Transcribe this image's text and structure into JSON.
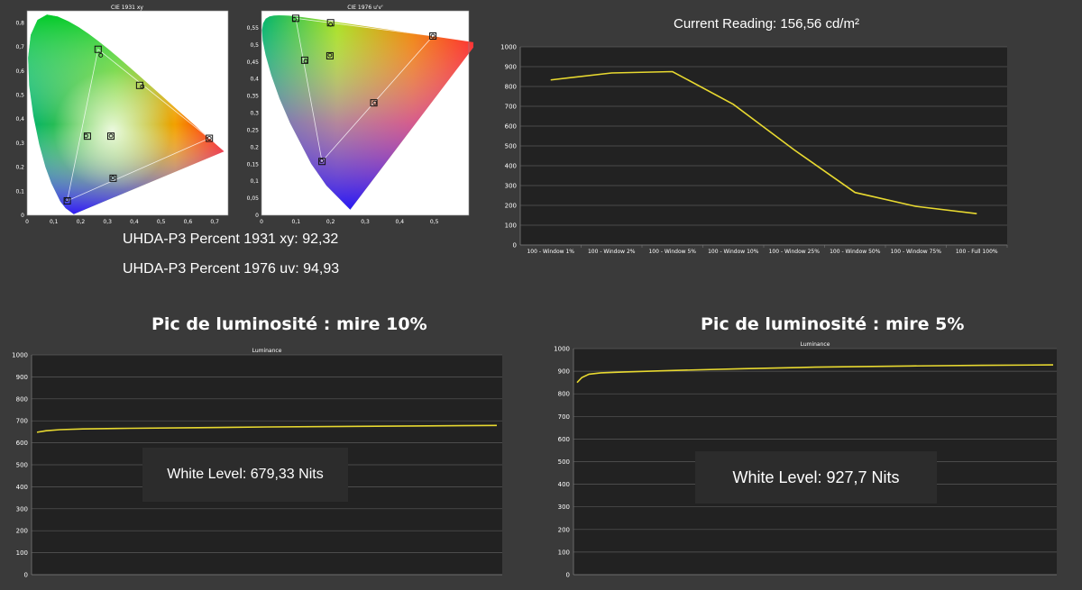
{
  "colors": {
    "background": "#3a3a3a",
    "plot_bg": "#222222",
    "grid": "#5a5a5a",
    "line": "#e8d930",
    "text": "#ffffff"
  },
  "cie1931": {
    "title": "CIE 1931 xy",
    "caption": "UHDA-P3 Percent 1931 xy: 92,32"
  },
  "cie1976": {
    "title": "CIE 1976 u'v'",
    "caption": "UHDA-P3 Percent 1976 uv: 94,93"
  },
  "reading": {
    "title": "Current Reading: 156,56 cd/m²"
  },
  "peak10": {
    "heading": "Pic de luminosité : mire 10%",
    "white_level": "White Level: 679,33 Nits"
  },
  "peak5": {
    "heading": "Pic de luminosité : mire 5%",
    "white_level": "White Level: 927,7 Nits"
  },
  "chart_data": [
    {
      "id": "cie1931",
      "type": "scatter",
      "title": "CIE 1931 xy",
      "xlim": [
        0,
        0.75
      ],
      "ylim": [
        0,
        0.85
      ],
      "x_ticks": [
        0,
        0.1,
        0.2,
        0.3,
        0.4,
        0.5,
        0.6,
        0.7
      ],
      "y_ticks": [
        0,
        0.1,
        0.2,
        0.3,
        0.4,
        0.5,
        0.6,
        0.7,
        0.8
      ],
      "x_tick_labels": [
        "0",
        "0,1",
        "0,2",
        "0,3",
        "0,4",
        "0,5",
        "0,6",
        "0,7"
      ],
      "y_tick_labels": [
        "0",
        "0,1",
        "0,2",
        "0,3",
        "0,4",
        "0,5",
        "0,6",
        "0,7",
        "0,8"
      ],
      "target_points": [
        [
          0.68,
          0.32
        ],
        [
          0.265,
          0.69
        ],
        [
          0.15,
          0.06
        ],
        [
          0.3127,
          0.329
        ],
        [
          0.225,
          0.329
        ],
        [
          0.321,
          0.154
        ],
        [
          0.42,
          0.54
        ]
      ],
      "measured_points": [
        [
          0.68,
          0.32
        ],
        [
          0.275,
          0.665
        ],
        [
          0.148,
          0.065
        ],
        [
          0.313,
          0.33
        ],
        [
          0.22,
          0.33
        ],
        [
          0.32,
          0.155
        ],
        [
          0.43,
          0.535
        ]
      ]
    },
    {
      "id": "cie1976",
      "type": "scatter",
      "title": "CIE 1976 u'v'",
      "xlim": [
        0,
        0.6
      ],
      "ylim": [
        0,
        0.6
      ],
      "x_ticks": [
        0,
        0.1,
        0.2,
        0.3,
        0.4,
        0.5
      ],
      "y_ticks": [
        0,
        0.05,
        0.1,
        0.15,
        0.2,
        0.25,
        0.3,
        0.35,
        0.4,
        0.45,
        0.5,
        0.55
      ],
      "x_tick_labels": [
        "0",
        "0,1",
        "0,2",
        "0,3",
        "0,4",
        "0,5"
      ],
      "y_tick_labels": [
        "0",
        "0,05",
        "0,1",
        "0,15",
        "0,2",
        "0,25",
        "0,3",
        "0,35",
        "0,4",
        "0,45",
        "0,5",
        "0,55"
      ],
      "target_points": [
        [
          0.496,
          0.526
        ],
        [
          0.099,
          0.578
        ],
        [
          0.175,
          0.158
        ],
        [
          0.198,
          0.468
        ],
        [
          0.2,
          0.565
        ],
        [
          0.125,
          0.455
        ],
        [
          0.325,
          0.33
        ]
      ],
      "measured_points": [
        [
          0.496,
          0.526
        ],
        [
          0.095,
          0.575
        ],
        [
          0.174,
          0.16
        ],
        [
          0.198,
          0.47
        ],
        [
          0.2,
          0.56
        ],
        [
          0.128,
          0.452
        ],
        [
          0.328,
          0.33
        ]
      ]
    },
    {
      "id": "window",
      "type": "line",
      "categories": [
        "100 - Window  1%",
        "100 - Window  2%",
        "100 - Window  5%",
        "100 - Window 10%",
        "100 - Window 25%",
        "100 - Window 50%",
        "100 - Window 75%",
        "100 - Full  100%"
      ],
      "values": [
        833,
        868,
        875,
        710,
        480,
        265,
        195,
        158
      ],
      "ylim": [
        0,
        1000
      ],
      "y_ticks": [
        0,
        100,
        200,
        300,
        400,
        500,
        600,
        700,
        800,
        900,
        1000
      ],
      "grid": true
    },
    {
      "id": "peak10",
      "type": "line",
      "title": "Luminance",
      "x": [
        0,
        0.02,
        0.05,
        0.1,
        0.2,
        0.35,
        0.5,
        0.7,
        0.85,
        1
      ],
      "values": [
        648,
        655,
        660,
        663,
        666,
        669,
        672,
        675,
        677,
        679
      ],
      "ylim": [
        0,
        1000
      ],
      "y_ticks": [
        0,
        100,
        200,
        300,
        400,
        500,
        600,
        700,
        800,
        900,
        1000
      ],
      "grid": true
    },
    {
      "id": "peak5",
      "type": "line",
      "title": "Luminance",
      "x": [
        0,
        0.01,
        0.025,
        0.05,
        0.1,
        0.2,
        0.35,
        0.5,
        0.7,
        0.85,
        1
      ],
      "values": [
        850,
        872,
        887,
        893,
        897,
        903,
        911,
        918,
        923,
        926,
        928
      ],
      "ylim": [
        0,
        1000
      ],
      "y_ticks": [
        0,
        100,
        200,
        300,
        400,
        500,
        600,
        700,
        800,
        900,
        1000
      ],
      "grid": true
    }
  ]
}
